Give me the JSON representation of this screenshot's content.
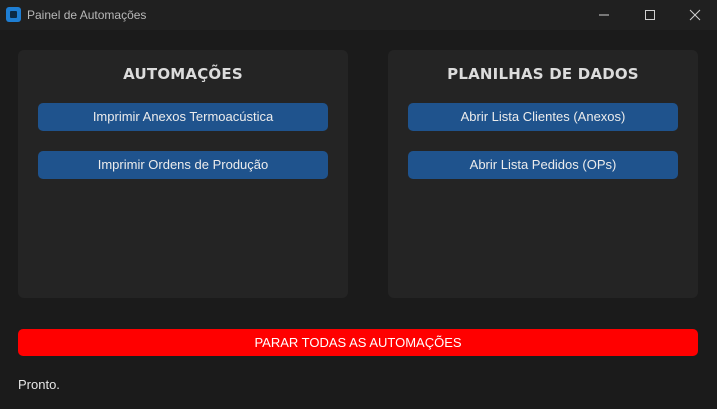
{
  "window": {
    "title": "Painel de Automações",
    "icon": "app-icon",
    "controls": [
      "minimize-icon",
      "maximize-icon",
      "close-icon"
    ]
  },
  "automations_panel": {
    "title": "AUTOMAÇÕES",
    "buttons": [
      {
        "label": "Imprimir Anexos Termoacústica"
      },
      {
        "label": "Imprimir Ordens de Produção"
      }
    ]
  },
  "spreadsheets_panel": {
    "title": "PLANILHAS DE DADOS",
    "buttons": [
      {
        "label": "Abrir Lista Clientes (Anexos)"
      },
      {
        "label": "Abrir Lista Pedidos (OPs)"
      }
    ]
  },
  "stop_all": {
    "label": "PARAR TODAS AS AUTOMAÇÕES"
  },
  "status": {
    "text": "Pronto."
  },
  "colors": {
    "background": "#1b1b1b",
    "panel": "#242424",
    "button": "#1f538d",
    "danger": "#ff0000"
  }
}
